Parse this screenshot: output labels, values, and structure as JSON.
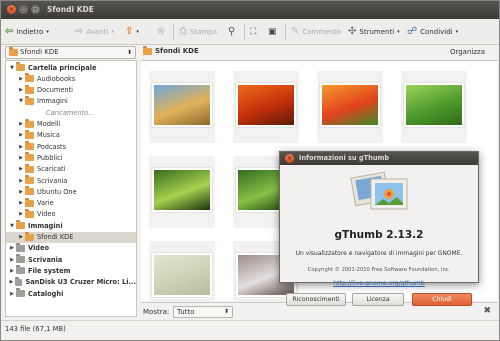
{
  "window": {
    "title": "Sfondi KDE"
  },
  "toolbar": {
    "back": "Indietro",
    "forward": "Avanti",
    "print": "Stampa",
    "comments": "Commento",
    "tools": "Strumenti",
    "share": "Condividi"
  },
  "location": {
    "combo": "Sfondi KDE",
    "breadcrumb": "Sfondi KDE",
    "organize": "Organizza"
  },
  "tree": [
    {
      "label": "Cartella principale",
      "depth": 0,
      "expanded": "down",
      "bold": true,
      "icon": "home-folder-icon"
    },
    {
      "label": "Audiobooks",
      "depth": 1,
      "expanded": "right",
      "icon": "folder-icon"
    },
    {
      "label": "Documenti",
      "depth": 1,
      "expanded": "right",
      "icon": "folder-icon"
    },
    {
      "label": "Immagini",
      "depth": 1,
      "expanded": "down",
      "icon": "folder-icon"
    },
    {
      "label": "Caricamento...",
      "depth": 2,
      "expanded": "",
      "italic": true
    },
    {
      "label": "Modelli",
      "depth": 1,
      "expanded": "right",
      "icon": "folder-icon"
    },
    {
      "label": "Musica",
      "depth": 1,
      "expanded": "right",
      "icon": "folder-icon"
    },
    {
      "label": "Podcasts",
      "depth": 1,
      "expanded": "right",
      "icon": "folder-icon"
    },
    {
      "label": "Pubblici",
      "depth": 1,
      "expanded": "right",
      "icon": "folder-icon"
    },
    {
      "label": "Scaricati",
      "depth": 1,
      "expanded": "right",
      "icon": "folder-icon"
    },
    {
      "label": "Scrivania",
      "depth": 1,
      "expanded": "right",
      "icon": "folder-icon"
    },
    {
      "label": "Ubuntu One",
      "depth": 1,
      "expanded": "right",
      "icon": "folder-icon"
    },
    {
      "label": "Varie",
      "depth": 1,
      "expanded": "right",
      "icon": "folder-icon"
    },
    {
      "label": "Video",
      "depth": 1,
      "expanded": "right",
      "icon": "folder-icon"
    },
    {
      "label": "Immagini",
      "depth": 0,
      "expanded": "down",
      "bold": true,
      "icon": "pictures-folder-icon"
    },
    {
      "label": "Sfondi KDE",
      "depth": 1,
      "expanded": "right",
      "selected": true,
      "icon": "folder-icon"
    },
    {
      "label": "Video",
      "depth": 0,
      "expanded": "right",
      "bold": true,
      "icon": "video-folder-icon"
    },
    {
      "label": "Scrivania",
      "depth": 0,
      "expanded": "right",
      "bold": true,
      "icon": "desktop-folder-icon"
    },
    {
      "label": "File system",
      "depth": 0,
      "expanded": "right",
      "bold": true,
      "icon": "filesystem-icon"
    },
    {
      "label": "SanDisk U3 Cruzer Micro: Li...",
      "depth": 0,
      "expanded": "right",
      "bold": true,
      "icon": "usb-drive-icon"
    },
    {
      "label": "Cataloghi",
      "depth": 0,
      "expanded": "right",
      "bold": true,
      "icon": "catalog-icon"
    }
  ],
  "thumbnails": [
    {
      "name": "thumb-grass-field",
      "colors": [
        "#6fa6d6",
        "#e0b25a",
        "#8c6a2b"
      ]
    },
    {
      "name": "thumb-orange-flower",
      "colors": [
        "#f06a18",
        "#c42f0b",
        "#5a1c07"
      ]
    },
    {
      "name": "thumb-orange-flower-2",
      "colors": [
        "#f59a2e",
        "#e2421b",
        "#3c8a2a"
      ]
    },
    {
      "name": "thumb-green-grass",
      "colors": [
        "#9dd45d",
        "#4e9a2a",
        "#2f6b1c"
      ]
    },
    {
      "name": "thumb-green-leaves",
      "colors": [
        "#3b6a1f",
        "#a6d24f",
        "#18320d"
      ]
    },
    {
      "name": "thumb-green-drop",
      "colors": [
        "#356b22",
        "#86c145",
        "#1e3d12"
      ]
    },
    {
      "name": "thumb-pale-texture",
      "colors": [
        "#e2e4cf",
        "#cfd1b6",
        "#b8ba9c"
      ]
    },
    {
      "name": "thumb-frost-trees",
      "colors": [
        "#9a8c86",
        "#e4e0e0",
        "#5a4c48"
      ]
    }
  ],
  "filter": {
    "label": "Mostra:",
    "value": "Tutto"
  },
  "status": {
    "text": "143 file (67,1 MB)"
  },
  "about": {
    "title": "Informazioni su gThumb",
    "app": "gThumb 2.13.2",
    "description": "Un visualizzatore e navigatore di immagini per GNOME.",
    "copyright": "Copyright © 2001-2010 Free Software Foundation, Inc.",
    "url": "http://live.gnome.org/gthumb",
    "credits": "Riconoscimenti",
    "license": "Licenza",
    "close": "Chiudi"
  }
}
